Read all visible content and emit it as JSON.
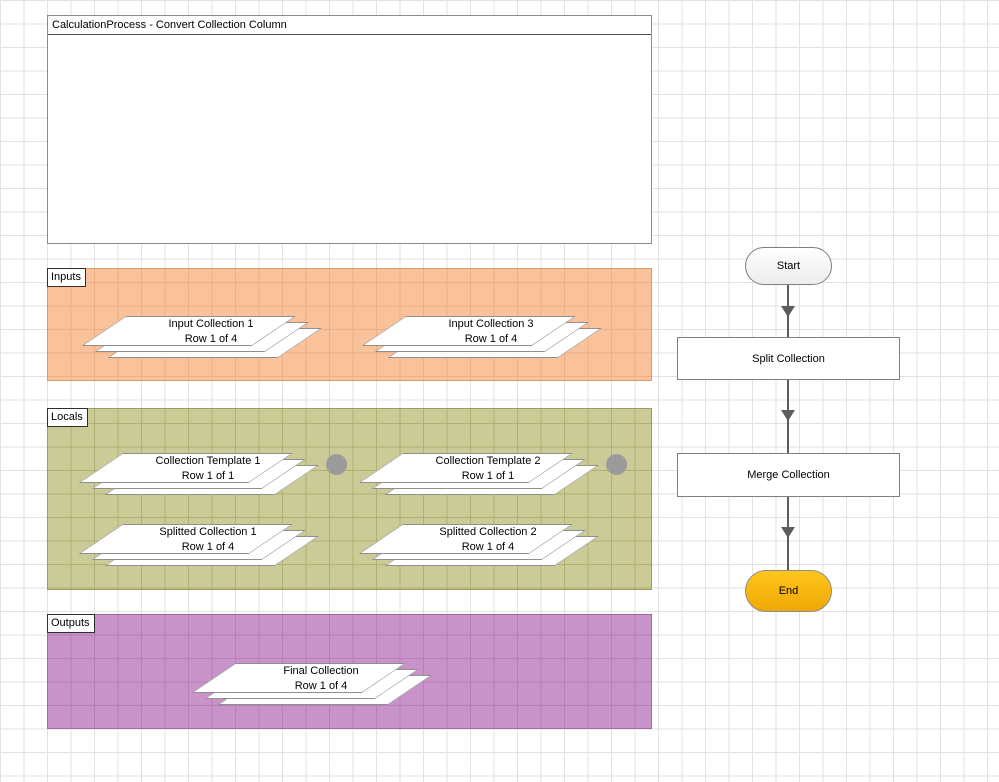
{
  "diagram": {
    "title": "CalculationProcess - Convert Collection Column"
  },
  "sections": {
    "inputs": {
      "label": "Inputs",
      "fill_color": "#fac29a",
      "stages": [
        {
          "title": "Input Collection 1",
          "row": "Row 1 of 4"
        },
        {
          "title": "Input Collection 3",
          "row": "Row 1 of 4"
        }
      ]
    },
    "locals": {
      "label": "Locals",
      "fill_color": "#cbcb98",
      "stages": [
        {
          "title": "Collection Template 1",
          "row": "Row 1 of 1",
          "indicator": "gray-dot"
        },
        {
          "title": "Collection Template 2",
          "row": "Row 1 of 1",
          "indicator": "gray-dot"
        },
        {
          "title": "Splitted Collection 1",
          "row": "Row 1 of 4"
        },
        {
          "title": "Splitted Collection 2",
          "row": "Row 1 of 4"
        }
      ]
    },
    "outputs": {
      "label": "Outputs",
      "fill_color": "#c893c8",
      "stages": [
        {
          "title": "Final Collection",
          "row": "Row 1 of 4"
        }
      ]
    }
  },
  "flow": {
    "start_label": "Start",
    "steps": [
      {
        "label": "Split Collection"
      },
      {
        "label": "Merge Collection"
      }
    ],
    "end_label": "End",
    "end_color": "#f7b411",
    "link_color": "#5c5c5c"
  }
}
